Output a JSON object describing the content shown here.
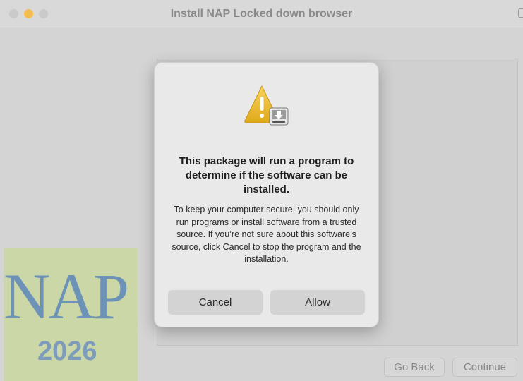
{
  "window": {
    "title": "Install NAP Locked down browser"
  },
  "background": {
    "logo_text": "NAP",
    "logo_year": "2026",
    "go_back_label": "Go Back",
    "continue_label": "Continue"
  },
  "dialog": {
    "icon": "warning-triangle-with-installer-icon",
    "title": "This package will run a program to determine if the software can be installed.",
    "body": "To keep your computer secure, you should only run programs or install software from a trusted source. If you’re not sure about this software’s source, click Cancel to stop the program and the installation.",
    "cancel_label": "Cancel",
    "allow_label": "Allow"
  },
  "colors": {
    "minimize_button": "#f5bd4f",
    "logo_background": "#cbd7a6",
    "logo_text": "#6d92b8",
    "warning_yellow": "#f2c330"
  }
}
